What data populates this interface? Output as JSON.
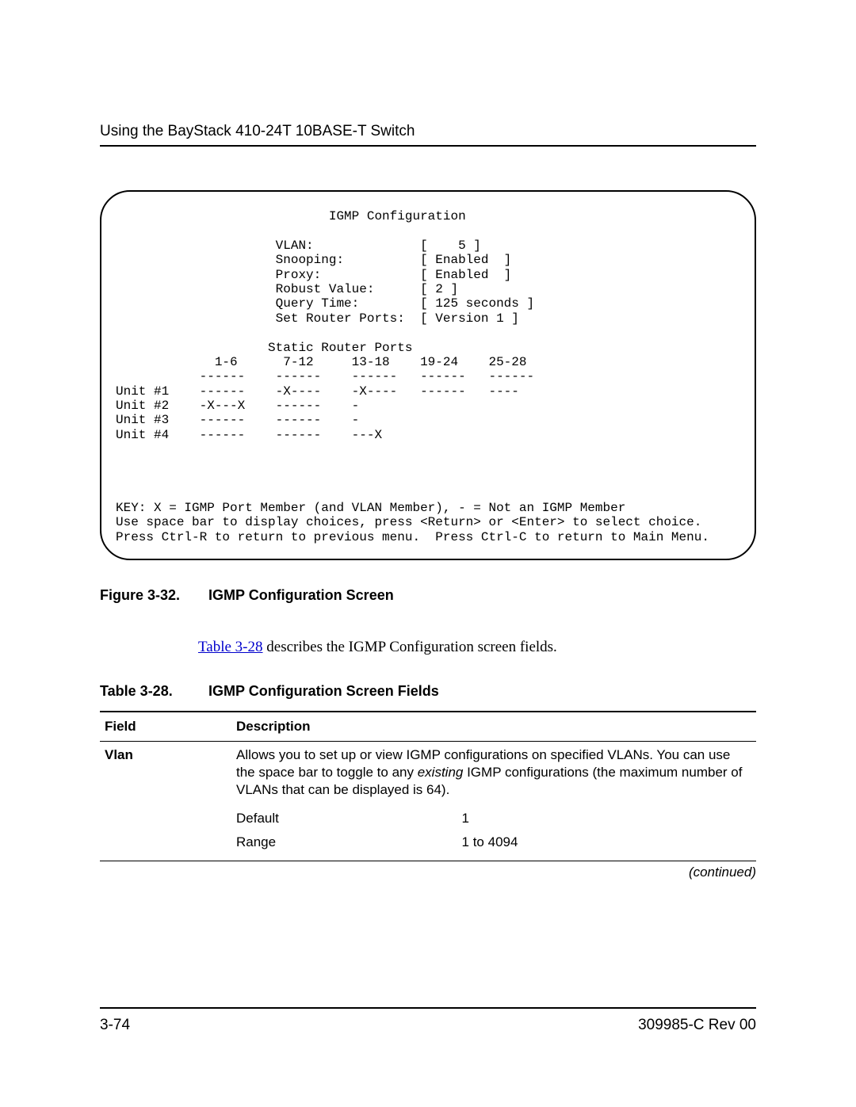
{
  "header": {
    "title": "Using the BayStack 410-24T 10BASE-T Switch"
  },
  "terminal": {
    "text": "                            IGMP Configuration\n\n                     VLAN:              [    5 ]\n                     Snooping:          [ Enabled  ]\n                     Proxy:             [ Enabled  ]\n                     Robust Value:      [ 2 ]\n                     Query Time:        [ 125 seconds ]\n                     Set Router Ports:  [ Version 1 ]\n\n                    Static Router Ports\n             1-6      7-12     13-18    19-24    25-28\n           ------    ------    ------   ------   ------\nUnit #1    ------    -X----    -X----   ------   ----\nUnit #2    -X---X    ------    -\nUnit #3    ------    ------    -\nUnit #4    ------    ------    ---X\n\n\n\n\nKEY: X = IGMP Port Member (and VLAN Member), - = Not an IGMP Member\nUse space bar to display choices, press <Return> or <Enter> to select choice.\nPress Ctrl-R to return to previous menu.  Press Ctrl-C to return to Main Menu."
  },
  "figure": {
    "label": "Figure 3-32.",
    "title": "IGMP Configuration Screen"
  },
  "paragraph": {
    "link_text": "Table 3-28",
    "rest": " describes the IGMP Configuration screen fields."
  },
  "table_caption": {
    "label": "Table 3-28.",
    "title": "IGMP Configuration Screen Fields"
  },
  "table": {
    "headers": {
      "field": "Field",
      "description": "Description"
    },
    "rows": [
      {
        "field": "Vlan",
        "desc_pre": "Allows you to set up or view IGMP configurations on specified VLANs. You can use the space bar to toggle to any ",
        "desc_em": "existing",
        "desc_post": " IGMP configurations (the maximum number of VLANs that can be displayed is 64).",
        "sub": [
          {
            "label": "Default",
            "value": "1"
          },
          {
            "label": "Range",
            "value": "1 to 4094"
          }
        ]
      }
    ],
    "continued": "(continued)"
  },
  "footer": {
    "page": "3-74",
    "docrev": "309985-C Rev 00"
  }
}
